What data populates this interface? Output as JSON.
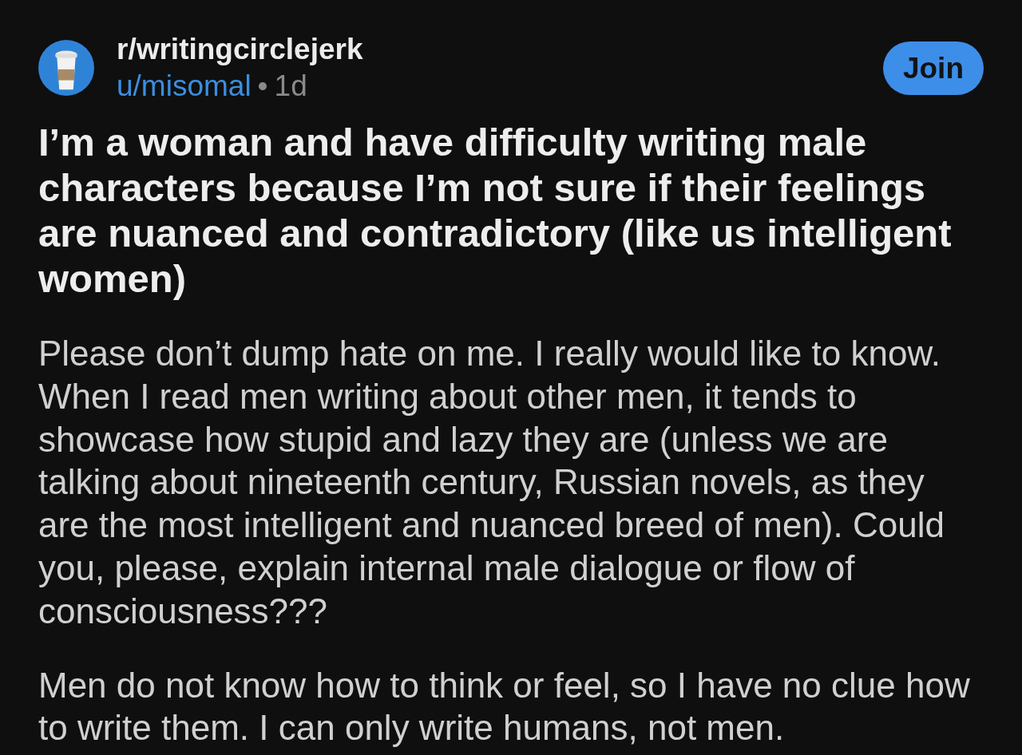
{
  "header": {
    "community": "r/writingcirclejerk",
    "author": "u/misomal",
    "separator": "•",
    "age": "1d",
    "join_button": "Join"
  },
  "post": {
    "title": "I’m a woman and have difficulty writing male characters because I’m not sure if their feelings are nuanced and contradictory (like us intelligent women)",
    "paragraphs": [
      "Please don’t dump hate on me. I really would like to know. When I read men writing about other men, it tends to showcase how stupid and lazy they are (unless we are talking about nineteenth century, Russian novels, as they are the most intelligent and nuanced breed of men). Could you, please, explain internal male dialogue or flow of consciousness???",
      "Men do not know how to think or feel, so I have no clue how to write them. I can only write humans, not men."
    ]
  }
}
